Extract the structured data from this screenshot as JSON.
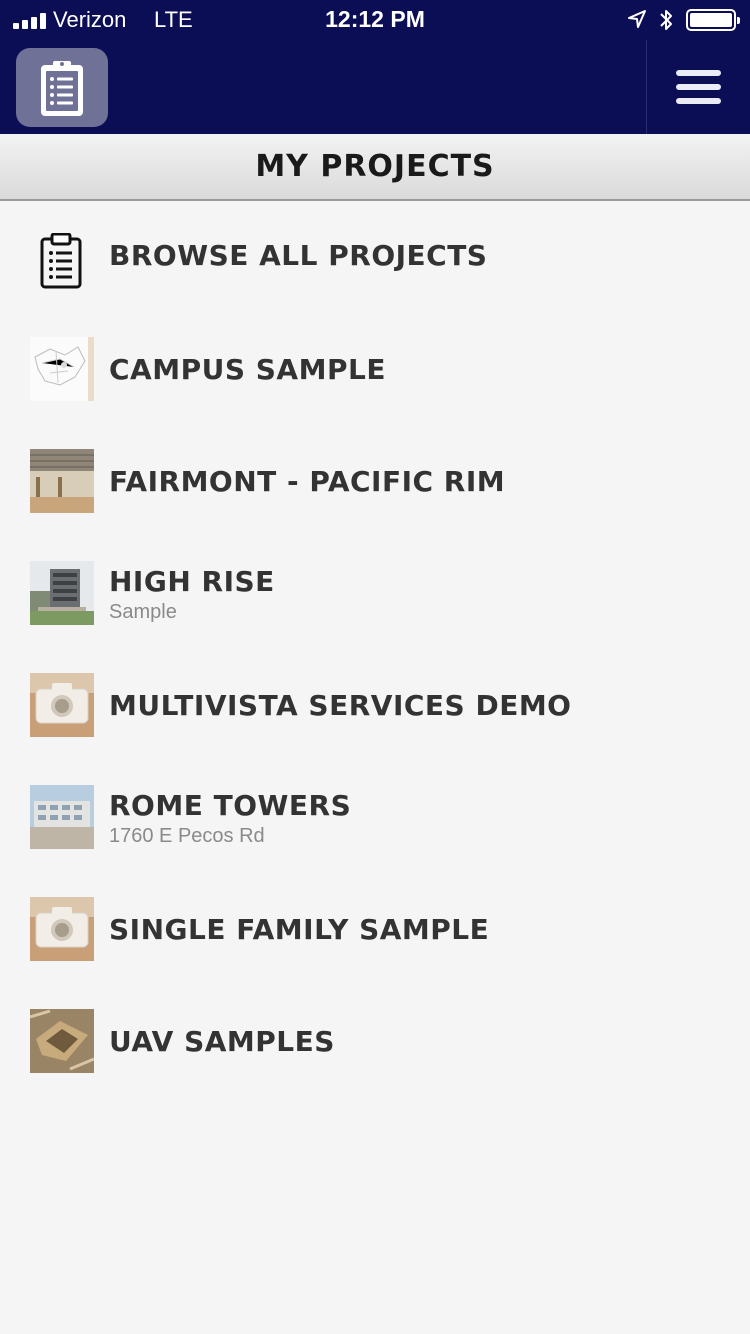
{
  "status_bar": {
    "carrier": "Verizon",
    "network": "LTE",
    "time": "12:12 PM"
  },
  "header": {
    "app_icon": "clipboard-icon",
    "menu_icon": "hamburger-menu-icon"
  },
  "title": "MY PROJECTS",
  "browse": {
    "label": "BROWSE ALL PROJECTS",
    "icon": "clipboard-list-icon"
  },
  "projects": [
    {
      "title": "CAMPUS SAMPLE",
      "subtitle": "",
      "thumb": "site-plan-thumbnail"
    },
    {
      "title": "FAIRMONT - PACIFIC RIM",
      "subtitle": "",
      "thumb": "building-photo-thumbnail"
    },
    {
      "title": "HIGH RISE",
      "subtitle": "Sample",
      "thumb": "high-rise-photo-thumbnail"
    },
    {
      "title": "MULTIVISTA SERVICES DEMO",
      "subtitle": "",
      "thumb": "camera-placeholder-thumbnail"
    },
    {
      "title": "ROME TOWERS",
      "subtitle": "1760 E Pecos Rd",
      "thumb": "towers-photo-thumbnail"
    },
    {
      "title": "SINGLE FAMILY SAMPLE",
      "subtitle": "",
      "thumb": "camera-placeholder-thumbnail"
    },
    {
      "title": "UAV SAMPLES",
      "subtitle": "",
      "thumb": "aerial-photo-thumbnail"
    }
  ],
  "colors": {
    "header_bg": "#0c0e55",
    "app_button_bg": "#6f7197",
    "list_bg": "#f5f5f5",
    "title_text": "#333333",
    "subtitle_text": "#8a8a8a"
  }
}
